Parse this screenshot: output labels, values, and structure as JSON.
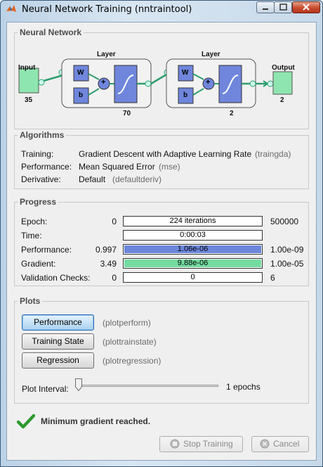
{
  "window": {
    "title": "Neural Network Training (nntraintool)"
  },
  "network": {
    "section_title": "Neural Network",
    "input_label": "Input",
    "input_size": "35",
    "layer1_label": "Layer",
    "layer1_size": "70",
    "layer2_label": "Layer",
    "layer2_size": "2",
    "output_label": "Output",
    "output_size": "2",
    "weight_label": "W",
    "bias_label": "b",
    "sum_symbol": "+",
    "colors": {
      "node": "#8fe5b0",
      "weight_box": "#6f86dc",
      "transfer_box": "#6f86dc",
      "connector": "#2e9e6e"
    }
  },
  "algorithms": {
    "section_title": "Algorithms",
    "rows": [
      {
        "label": "Training:",
        "value": "Gradient Descent with Adaptive Learning Rate",
        "code": "(traingda)"
      },
      {
        "label": "Performance:",
        "value": "Mean Squared Error",
        "code": "(mse)"
      },
      {
        "label": "Derivative:",
        "value": "Default",
        "code": "(defaultderiv)"
      }
    ]
  },
  "progress": {
    "section_title": "Progress",
    "rows": [
      {
        "label": "Epoch:",
        "start": "0",
        "bar_text": "224 iterations",
        "end": "500000",
        "fill": 0.0,
        "color": "#ffffff"
      },
      {
        "label": "Time:",
        "start": "",
        "bar_text": "0:00:03",
        "end": "",
        "fill": 0.0,
        "color": "#ffffff"
      },
      {
        "label": "Performance:",
        "start": "0.997",
        "bar_text": "1.06e-06",
        "end": "1.00e-09",
        "fill": 1.0,
        "color": "#6b86db"
      },
      {
        "label": "Gradient:",
        "start": "3.49",
        "bar_text": "9.88e-06",
        "end": "1.00e-05",
        "fill": 1.0,
        "color": "#73dba0"
      },
      {
        "label": "Validation Checks:",
        "start": "0",
        "bar_text": "0",
        "end": "6",
        "fill": 0.0,
        "color": "#ffffff"
      }
    ]
  },
  "plots": {
    "section_title": "Plots",
    "buttons": [
      {
        "label": "Performance",
        "code": "(plotperform)"
      },
      {
        "label": "Training State",
        "code": "(plottrainstate)"
      },
      {
        "label": "Regression",
        "code": "(plotregression)"
      }
    ],
    "interval_label": "Plot Interval:",
    "interval_value": "1 epochs",
    "interval_level": 0.0
  },
  "status": {
    "message": "Minimum gradient reached.",
    "icon": "checkmark-icon",
    "icon_color": "#2e9a2e"
  },
  "footer": {
    "stop_label": "Stop Training",
    "cancel_label": "Cancel"
  }
}
